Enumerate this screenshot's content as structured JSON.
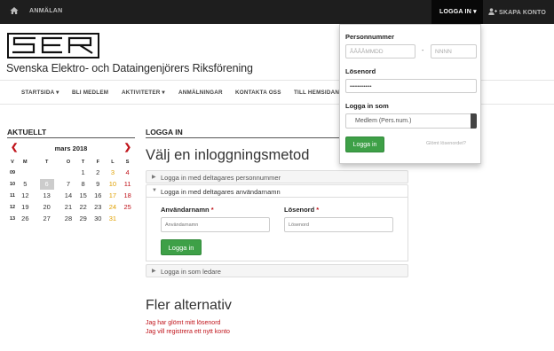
{
  "topbar": {
    "home_icon": "home-icon",
    "anmalan": "ANMÄLAN",
    "logga_in": "LOGGA IN ▾",
    "skapa_konto": "SKAPA KONTO",
    "user_plus_icon": "user-plus-icon"
  },
  "header": {
    "logo_text": "SER",
    "org_name": "Svenska Elektro- och Dataingenjörers Riksförening"
  },
  "nav": {
    "items": [
      "STARTSIDA ▾",
      "BLI MEDLEM",
      "AKTIVITETER ▾",
      "ANMÄLNINGAR",
      "KONTAKTA OSS",
      "TILL HEMSIDAN"
    ]
  },
  "aktuellt": {
    "title": "AKTUELLT",
    "month": "mars 2018",
    "prev": "❮",
    "next": "❯",
    "weekdays": [
      "V",
      "M",
      "T",
      "O",
      "T",
      "F",
      "L",
      "S"
    ],
    "weeks": [
      {
        "wk": "09",
        "days": [
          "",
          "",
          "",
          "1",
          "2",
          "3",
          "4"
        ]
      },
      {
        "wk": "10",
        "days": [
          "5",
          "6",
          "7",
          "8",
          "9",
          "10",
          "11"
        ]
      },
      {
        "wk": "11",
        "days": [
          "12",
          "13",
          "14",
          "15",
          "16",
          "17",
          "18"
        ]
      },
      {
        "wk": "12",
        "days": [
          "19",
          "20",
          "21",
          "22",
          "23",
          "24",
          "25"
        ]
      },
      {
        "wk": "13",
        "days": [
          "26",
          "27",
          "28",
          "29",
          "30",
          "31",
          ""
        ]
      }
    ],
    "today": "6"
  },
  "login": {
    "title": "LOGGA IN",
    "heading": "Välj en inloggningsmetod",
    "acc_personnummer": "Logga in med deltagares personnummer",
    "acc_username": "Logga in med deltagares användarnamn",
    "acc_leader": "Logga in som ledare",
    "username_label": "Användarnamn",
    "username_placeholder": "Användarnamn",
    "password_label": "Lösenord",
    "password_placeholder": "Lösenord",
    "required_mark": "*",
    "submit": "Logga in"
  },
  "alternatives": {
    "heading": "Fler alternativ",
    "forgot": "Jag har glömt mitt lösenord",
    "register": "Jag vill registrera ett nytt konto"
  },
  "dropdown": {
    "personnummer_label": "Personnummer",
    "date_placeholder": "ÅÅÅÅMMDD",
    "dash": "-",
    "nnnn_placeholder": "NNNN",
    "password_label": "Lösenord",
    "password_value": "••••••••••••••",
    "login_as_label": "Logga in som",
    "login_as_value": "Medlem (Pers.num.)",
    "submit": "Logga in",
    "forgot": "Glömt lösenordet?"
  },
  "colors": {
    "accent_red": "#c0141b",
    "button_green": "#3ea047",
    "topbar": "#1e1e1e"
  }
}
